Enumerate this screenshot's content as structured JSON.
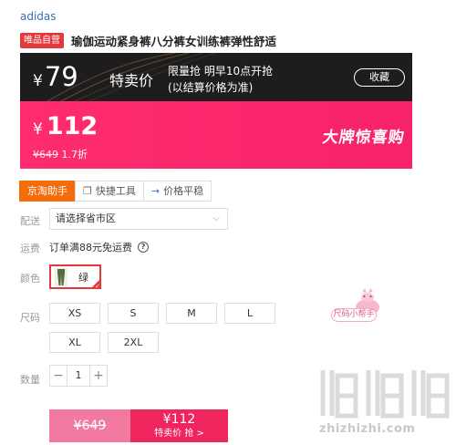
{
  "brand": "adidas",
  "product": {
    "tag": "唯品自营",
    "title": "瑜伽运动紧身裤八分裤女训练裤弹性舒适"
  },
  "flash_sale": {
    "currency": "¥",
    "price": "79",
    "label": "特卖价",
    "info_line1": "限量抢 明早10点开抢",
    "info_line2": "(以结算价格为准)",
    "collect_label": "收藏"
  },
  "promo": {
    "currency": "¥",
    "price": "112",
    "original": "¥649",
    "discount": "1.7折",
    "slogan": "大牌惊喜购"
  },
  "tools": [
    {
      "label": "京淘助手",
      "icon": "none"
    },
    {
      "label": "快捷工具",
      "icon": "copy-icon"
    },
    {
      "label": "价格平稳",
      "icon": "arrow-right-icon"
    }
  ],
  "labels": {
    "delivery": "配送",
    "shipping": "运费",
    "color": "颜色",
    "size": "尺码",
    "quantity": "数量"
  },
  "region": {
    "placeholder": "请选择省市区"
  },
  "shipping_text": "订单满88元免运费",
  "color_option": {
    "label": "绿",
    "swatch_color": "#556b3c"
  },
  "sizes": [
    "XS",
    "S",
    "M",
    "L",
    "XL",
    "2XL"
  ],
  "size_helper_label": "尺码小帮手",
  "quantity": {
    "value": "1",
    "minus": "−",
    "plus": "+"
  },
  "buy": {
    "original_price": "¥649",
    "price": "¥112",
    "label": "特卖价 抢 >"
  },
  "watermark_text": "zhizhizhi.com",
  "colors": {
    "accent_red": "#e4393c",
    "promo_pink": "#f7226a",
    "flash_dark": "#1e1c1d",
    "tool_orange": "#f56c0b"
  }
}
